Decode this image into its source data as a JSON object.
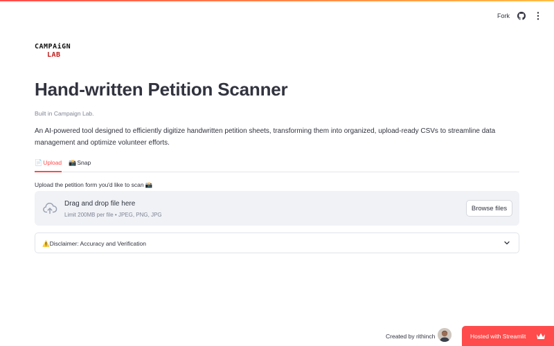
{
  "header": {
    "fork_label": "Fork",
    "github_icon": "github-icon",
    "menu_icon": "vertical-dots-menu-icon"
  },
  "logo": {
    "line1": "CAMPAiGN",
    "line2": "LAB"
  },
  "page": {
    "title": "Hand-written Petition Scanner",
    "caption": "Built in Campaign Lab.",
    "description": "An AI-powered tool designed to efficiently digitize handwritten petition sheets, transforming them into organized, upload-ready CSVs to streamline data management and optimize volunteer efforts."
  },
  "tabs": [
    {
      "emoji": "📄",
      "label": "Upload",
      "active": true
    },
    {
      "emoji": "📸",
      "label": "Snap",
      "active": false
    }
  ],
  "uploader": {
    "label": "Upload the petition form you'd like to scan 📸",
    "drag_text": "Drag and drop file here",
    "limit_text": "Limit 200MB per file • JPEG, PNG, JPG",
    "browse_label": "Browse files",
    "icon": "cloud-upload-icon"
  },
  "expander": {
    "label": "⚠️Disclaimer: Accuracy and Verification",
    "icon": "chevron-down-icon"
  },
  "footer": {
    "created_by": "Created by rithinch",
    "hosted_label": "Hosted with Streamlit",
    "crown_icon": "streamlit-crown-icon"
  },
  "colors": {
    "accent": "#ff4b4b",
    "text": "#31333f",
    "muted": "#808495",
    "dropzone_bg": "#f0f2f6",
    "logo_red": "#c21a1a"
  }
}
